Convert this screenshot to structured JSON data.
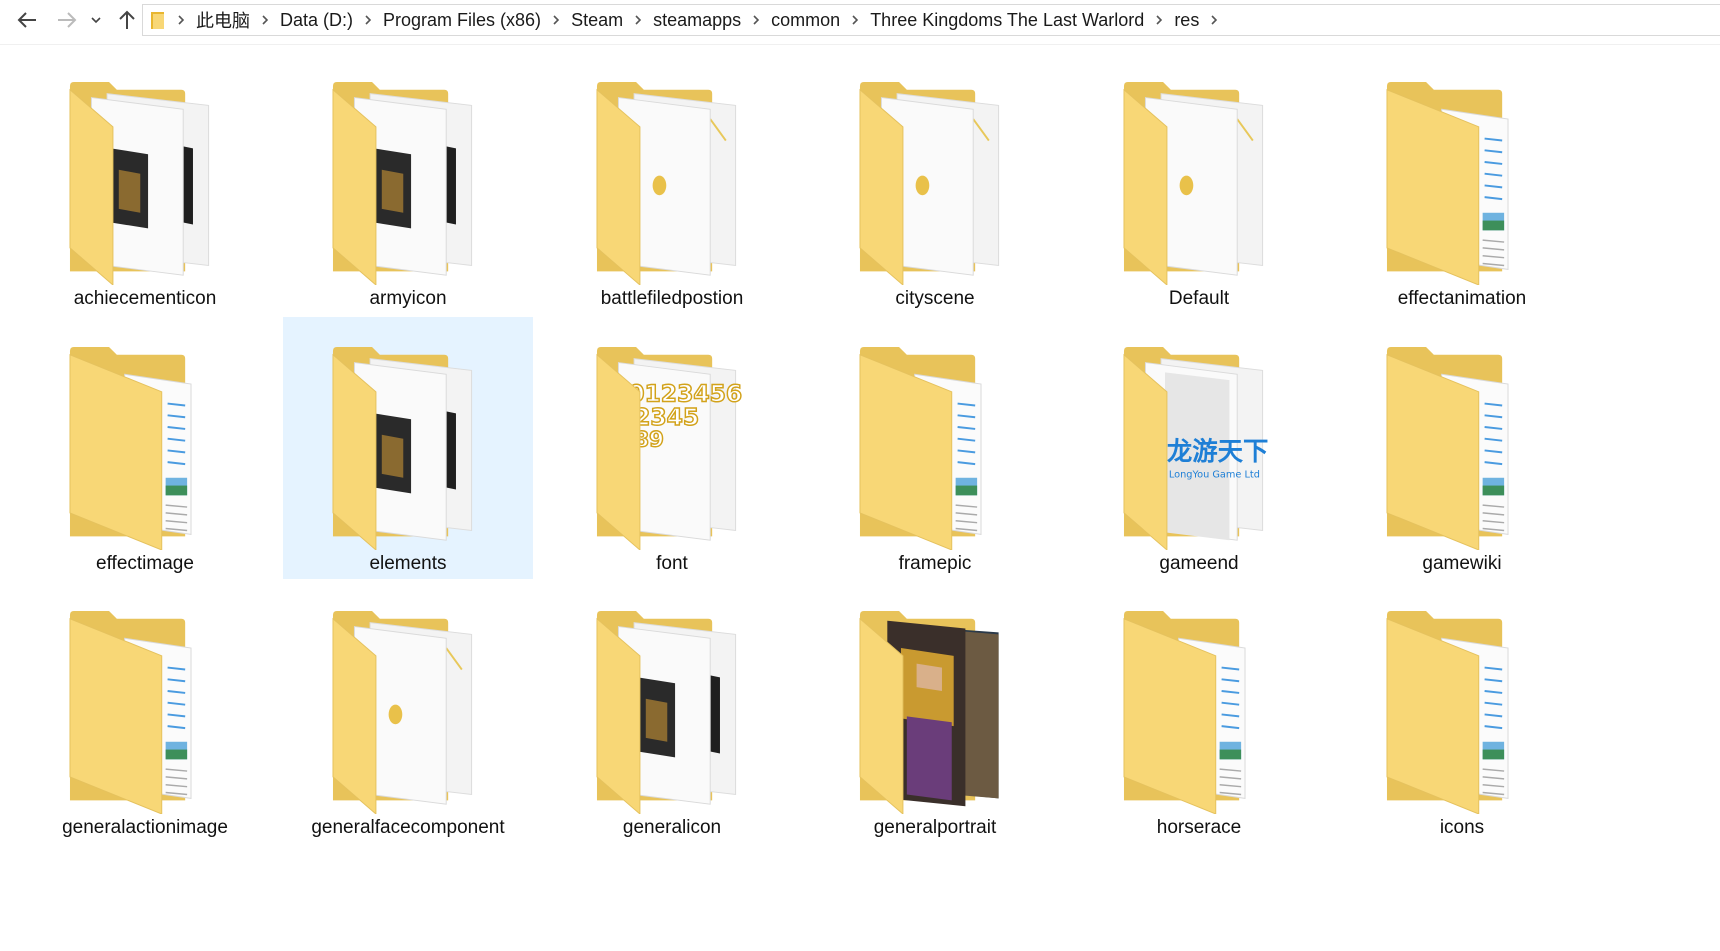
{
  "navigation": {
    "back_icon": "back-arrow-icon",
    "forward_icon": "forward-arrow-icon",
    "recent_icon": "chevron-down-icon",
    "up_icon": "up-arrow-icon"
  },
  "breadcrumb": [
    "此电脑",
    "Data (D:)",
    "Program Files (x86)",
    "Steam",
    "steamapps",
    "common",
    "Three Kingdoms The Last Warlord",
    "res"
  ],
  "folders": [
    {
      "name": "achiecementicon",
      "preview": "photo-pair"
    },
    {
      "name": "armyicon",
      "preview": "photo-pair"
    },
    {
      "name": "battlefiledpostion",
      "preview": "pages"
    },
    {
      "name": "cityscene",
      "preview": "pages"
    },
    {
      "name": "Default",
      "preview": "pages"
    },
    {
      "name": "effectanimation",
      "preview": "document"
    },
    {
      "name": "effectimage",
      "preview": "document"
    },
    {
      "name": "elements",
      "preview": "photo-pair",
      "selected": true
    },
    {
      "name": "font",
      "preview": "digits"
    },
    {
      "name": "framepic",
      "preview": "document"
    },
    {
      "name": "gameend",
      "preview": "logo"
    },
    {
      "name": "gamewiki",
      "preview": "document"
    },
    {
      "name": "generalactionimage",
      "preview": "document"
    },
    {
      "name": "generalfacecomponent",
      "preview": "pages"
    },
    {
      "name": "generalicon",
      "preview": "photo-pair"
    },
    {
      "name": "generalportrait",
      "preview": "portrait"
    },
    {
      "name": "horserace",
      "preview": "document"
    },
    {
      "name": "icons",
      "preview": "document"
    }
  ],
  "preview_text": {
    "font_digits": "0123456 2345 89",
    "gameend_logo": "龙游天下 LongYou Game Ltd"
  },
  "colors": {
    "folder_back": "#e8c35a",
    "folder_front": "#f8d776",
    "selection": "#e5f3ff",
    "page": "#f7f7f7",
    "doc_line": "#4a9be0"
  }
}
